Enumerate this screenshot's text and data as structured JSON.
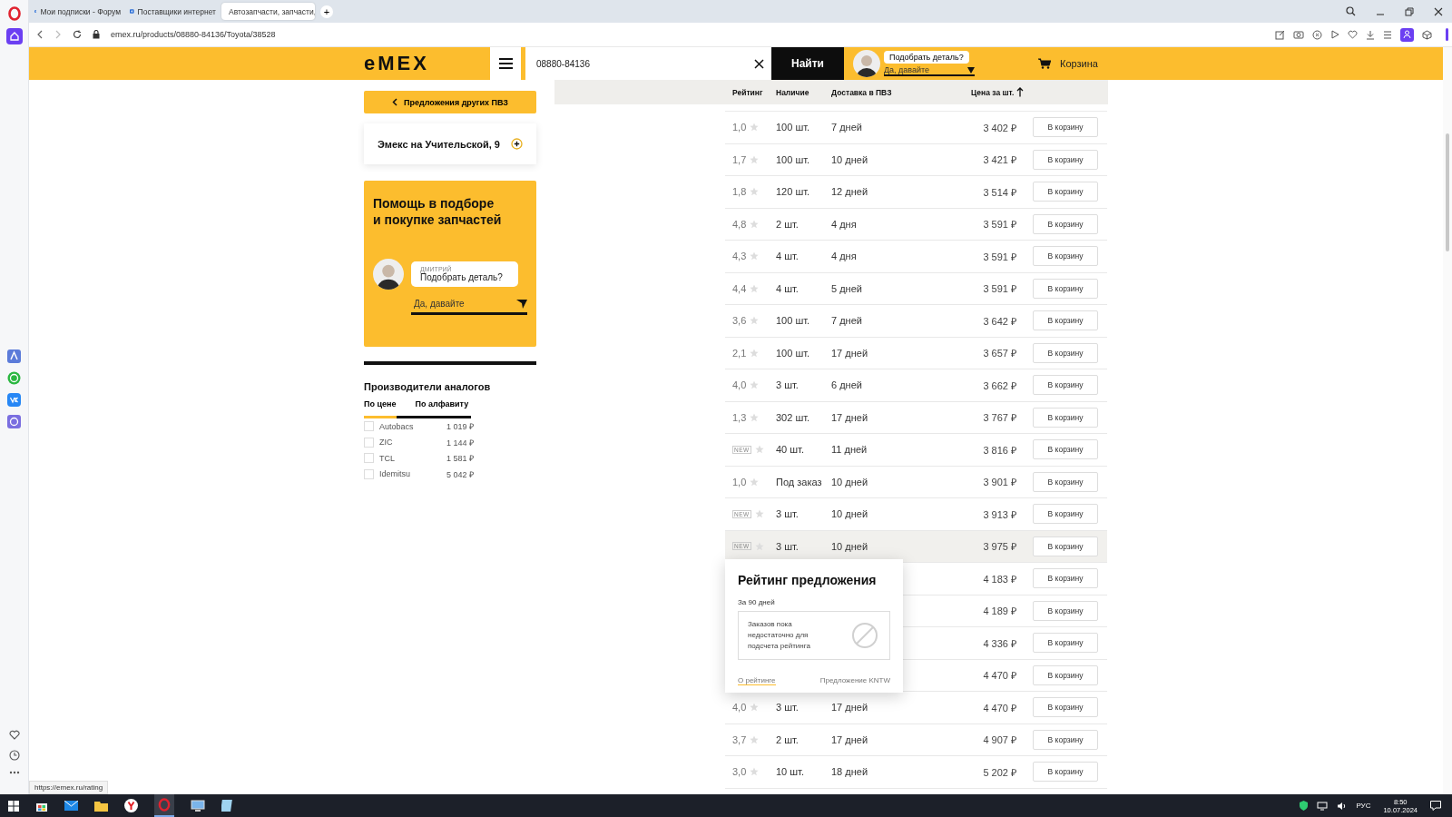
{
  "browser": {
    "tabs": [
      {
        "title": "Мои подписки - Форум",
        "selected": false
      },
      {
        "title": "Поставщики интернет",
        "selected": false
      },
      {
        "title": "Автозапчасти, запчасти,",
        "selected": true
      }
    ],
    "new_tab": "+",
    "address": "emex.ru/products/08880-84136/Toyota/38528",
    "status_url": "https://emex.ru/rating"
  },
  "header": {
    "logo": "eMEX",
    "search": {
      "value": "08880-84136"
    },
    "search_button": "Найти",
    "assistant": {
      "question": "Подобрать деталь?",
      "reply_placeholder": "Да, давайте"
    },
    "cart": "Корзина"
  },
  "sidebar": {
    "back_button": "Предложения других ПВЗ",
    "pickup_point": "Эмекс на Учительской, 9",
    "help": {
      "title": "Помощь в подборе\nи покупке запчастей",
      "agent_name": "ДМИТРИЙ",
      "message": "Подобрать деталь?",
      "reply_placeholder": "Да, давайте"
    },
    "analogs": {
      "title": "Производители аналогов",
      "tabs": [
        {
          "label": "По цене",
          "selected": true
        },
        {
          "label": "По алфавиту",
          "selected": false
        }
      ],
      "items": [
        {
          "name": "Autobacs",
          "price": "1 019 ₽",
          "checked": false
        },
        {
          "name": "ZIC",
          "price": "1 144 ₽",
          "checked": false
        },
        {
          "name": "TCL",
          "price": "1 581 ₽",
          "checked": false
        },
        {
          "name": "Idemitsu",
          "price": "5 042 ₽",
          "checked": false
        }
      ]
    }
  },
  "table": {
    "columns": [
      {
        "label": "Рейтинг"
      },
      {
        "label": "Наличие"
      },
      {
        "label": "Доставка в ПВЗ"
      },
      {
        "label": "Цена за шт.",
        "sort_ascending": true
      }
    ],
    "rows": [
      {
        "rating": {
          "kind": "score",
          "text": "1,0"
        },
        "availability": "100 шт.",
        "delivery": "7 дней",
        "price": "3 402 ₽",
        "button": "В корзину",
        "hovered": false
      },
      {
        "rating": {
          "kind": "score",
          "text": "1,7"
        },
        "availability": "100 шт.",
        "delivery": "10 дней",
        "price": "3 421 ₽",
        "button": "В корзину",
        "hovered": false
      },
      {
        "rating": {
          "kind": "score",
          "text": "1,8"
        },
        "availability": "120 шт.",
        "delivery": "12 дней",
        "price": "3 514 ₽",
        "button": "В корзину",
        "hovered": false
      },
      {
        "rating": {
          "kind": "score",
          "text": "4,8"
        },
        "availability": "2 шт.",
        "delivery": "4 дня",
        "price": "3 591 ₽",
        "button": "В корзину",
        "hovered": false
      },
      {
        "rating": {
          "kind": "score",
          "text": "4,3"
        },
        "availability": "4 шт.",
        "delivery": "4 дня",
        "price": "3 591 ₽",
        "button": "В корзину",
        "hovered": false
      },
      {
        "rating": {
          "kind": "score",
          "text": "4,4"
        },
        "availability": "4 шт.",
        "delivery": "5 дней",
        "price": "3 591 ₽",
        "button": "В корзину",
        "hovered": false
      },
      {
        "rating": {
          "kind": "score",
          "text": "3,6"
        },
        "availability": "100 шт.",
        "delivery": "7 дней",
        "price": "3 642 ₽",
        "button": "В корзину",
        "hovered": false
      },
      {
        "rating": {
          "kind": "score",
          "text": "2,1"
        },
        "availability": "100 шт.",
        "delivery": "17 дней",
        "price": "3 657 ₽",
        "button": "В корзину",
        "hovered": false
      },
      {
        "rating": {
          "kind": "score",
          "text": "4,0"
        },
        "availability": "3 шт.",
        "delivery": "6 дней",
        "price": "3 662 ₽",
        "button": "В корзину",
        "hovered": false
      },
      {
        "rating": {
          "kind": "score",
          "text": "1,3"
        },
        "availability": "302 шт.",
        "delivery": "17 дней",
        "price": "3 767 ₽",
        "button": "В корзину",
        "hovered": false
      },
      {
        "rating": {
          "kind": "new",
          "text": "NEW"
        },
        "availability": "40 шт.",
        "delivery": "11 дней",
        "price": "3 816 ₽",
        "button": "В корзину",
        "hovered": false
      },
      {
        "rating": {
          "kind": "score",
          "text": "1,0"
        },
        "availability": "Под заказ",
        "delivery": "10 дней",
        "price": "3 901 ₽",
        "button": "В корзину",
        "hovered": false
      },
      {
        "rating": {
          "kind": "new",
          "text": "NEW"
        },
        "availability": "3 шт.",
        "delivery": "10 дней",
        "price": "3 913 ₽",
        "button": "В корзину",
        "hovered": false
      },
      {
        "rating": {
          "kind": "new",
          "text": "NEW"
        },
        "availability": "3 шт.",
        "delivery": "10 дней",
        "price": "3 975 ₽",
        "button": "В корзину",
        "hovered": true
      },
      {
        "price": "4 183 ₽",
        "button": "В корзину",
        "hovered": false
      },
      {
        "price": "4 189 ₽",
        "button": "В корзину",
        "hovered": false
      },
      {
        "price": "4 336 ₽",
        "button": "В корзину",
        "hovered": false
      },
      {
        "price": "4 470 ₽",
        "button": "В корзину",
        "hovered": false
      },
      {
        "rating": {
          "kind": "score",
          "text": "4,0"
        },
        "availability": "3 шт.",
        "delivery": "17 дней",
        "price": "4 470 ₽",
        "button": "В корзину",
        "hovered": false
      },
      {
        "rating": {
          "kind": "score",
          "text": "3,7"
        },
        "availability": "2 шт.",
        "delivery": "17 дней",
        "price": "4 907 ₽",
        "button": "В корзину",
        "hovered": false
      },
      {
        "rating": {
          "kind": "score",
          "text": "3,0"
        },
        "availability": "10 шт.",
        "delivery": "18 дней",
        "price": "5 202 ₽",
        "button": "В корзину",
        "hovered": false
      }
    ]
  },
  "rating_popup": {
    "title": "Рейтинг предложения",
    "period": "За 90 дней",
    "message": "Заказов пока недостаточно для подсчета рейтинга",
    "links": [
      "О рейтинге",
      "Предложение KNTW"
    ]
  },
  "taskbar": {
    "language": "РУС",
    "time": "8:50",
    "date": "10.07.2024"
  }
}
